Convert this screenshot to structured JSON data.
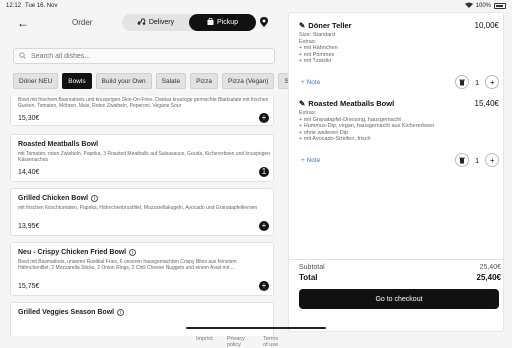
{
  "status": {
    "time": "12:12",
    "date": "Tue 16. Nov",
    "battery": "100%"
  },
  "header": {
    "title": "Order",
    "delivery_label": "Delivery",
    "pickup_label": "Pickup"
  },
  "search": {
    "placeholder": "Search all dishes..."
  },
  "categories": [
    "Döner NEU",
    "Bowls",
    "Build your Own",
    "Salate",
    "Pizza",
    "Pizza (Vegan)",
    "Sou"
  ],
  "products": [
    {
      "name": "",
      "desc": "Bowl mit frischem Basmatireis und knusprigen Skin-On-Fries. Dankar knackige gemischte Blattsalate mit frischen Gurken, Tomaten, Möhren, Mais, Roten Zwiebeln, Peperoni. Vegane Sour",
      "price": "15,30€"
    },
    {
      "name": "Roasted Meatballs Bowl",
      "desc": "mit Tomaten, roten Zwiebeln, Paprika, 3 Roasted Meatballs auf Salsasauce, Gouda, Kichererbsen und knusprigen Kässenachos",
      "price": "14,40€"
    },
    {
      "name": "Grilled Chicken Bowl",
      "desc": "mit frischen Kirschtomaten, Paprika, Hähnchenbrustfilet, Mozzarellakugeln, Avocado und Granatapfelkernen",
      "price": "13,95€"
    },
    {
      "name": "Neu - Crispy Chicken Fried Bowl",
      "desc": "Bowl mit Basmatireis, unseren Rustikal Fries, 6 unseren hausgemachten Crispy Bites aus feinstem Hähnchenfilet, 2 Mozzarella Sticks, 2 Onion Rings, 2 Chili Cheese Nuggets und einem Asiat mit ...",
      "price": "15,75€"
    },
    {
      "name": "Grilled Veggies Season Bowl",
      "desc": "",
      "price": ""
    }
  ],
  "cart": {
    "items": [
      {
        "name": "Döner Teller",
        "price": "10,00€",
        "lines": [
          "Size: Standard",
          "Extras:",
          "+ mit Hähnchen",
          "+ mit Pommes",
          "+ mit Tzatziki"
        ],
        "qty": "1",
        "note_label": "+ Note"
      },
      {
        "name": "Roasted Meatballs Bowl",
        "price": "15,40€",
        "lines": [
          "Extras:",
          "+ mit Granatapfel-Dressing, hausgemacht",
          "+ Hummus-Dip, vegan, hausgemacht aus Kichererbsen",
          "+ ohne weiteren Dip",
          "+ mit Avocado-Streifen, frisch"
        ],
        "qty": "1",
        "note_label": "+ Note"
      }
    ],
    "subtotal_label": "Subtotal",
    "subtotal": "25,40€",
    "total_label": "Total",
    "total": "25,40€",
    "checkout_label": "Go to checkout"
  },
  "footer": {
    "imprint": "Imprint",
    "privacy": "Privacy policy",
    "terms": "Terms of use"
  }
}
